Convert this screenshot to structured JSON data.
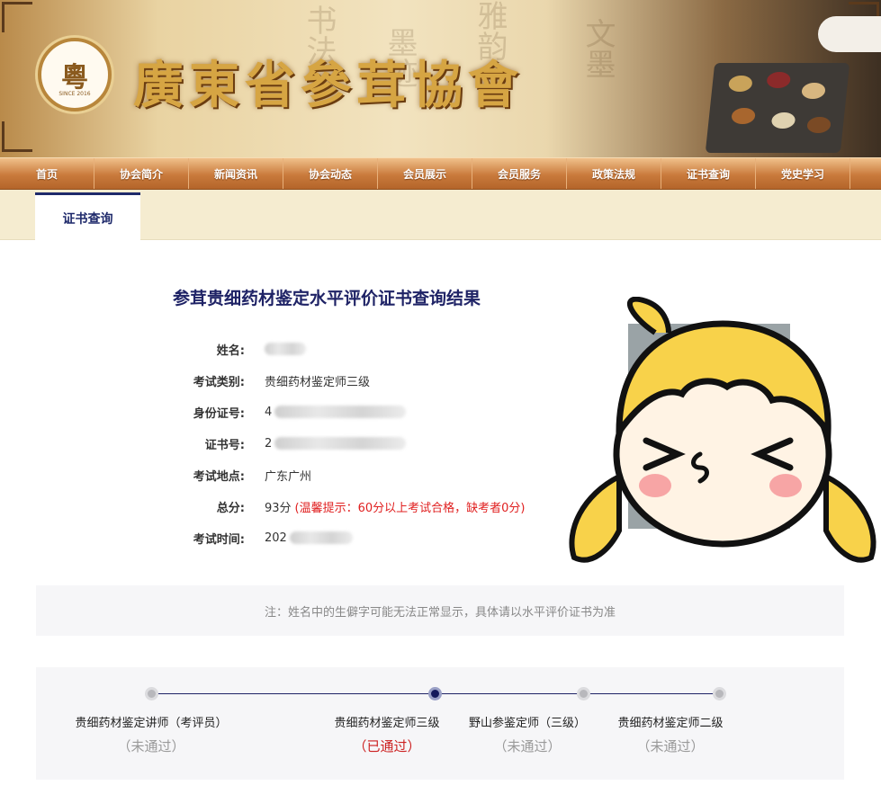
{
  "header": {
    "site_title": "廣東省參茸協會",
    "logo_mark": "粵",
    "logo_since": "SINCE 2016"
  },
  "nav": {
    "items": [
      "首页",
      "协会简介",
      "新闻资讯",
      "协会动态",
      "会员展示",
      "会员服务",
      "政策法规",
      "证书查询",
      "党史学习"
    ]
  },
  "tab": {
    "label": "证书查询"
  },
  "result": {
    "title": "参茸贵细药材鉴定水平评价证书查询结果",
    "fields": [
      {
        "label": "姓名:",
        "value": ""
      },
      {
        "label": "考试类别:",
        "value": "贵细药材鉴定师三级"
      },
      {
        "label": "身份证号:",
        "value": "4"
      },
      {
        "label": "证书号:",
        "value": "2"
      },
      {
        "label": "考试地点:",
        "value": "广东广州"
      },
      {
        "label": "总分:",
        "value": "93分",
        "hint": "(温馨提示：60分以上考试合格，缺考者0分)"
      },
      {
        "label": "考试时间:",
        "value": "202"
      }
    ]
  },
  "note": {
    "text": "注：姓名中的生僻字可能无法正常显示，具体请以水平评价证书为准"
  },
  "progress": {
    "steps": [
      {
        "label": "贵细药材鉴定讲师（考评员）",
        "status": "（未通过）",
        "passed": false
      },
      {
        "label": "贵细药材鉴定师三级",
        "status": "（已通过）",
        "passed": true
      },
      {
        "label": "野山参鉴定师（三级）",
        "status": "（未通过）",
        "passed": false
      },
      {
        "label": "贵细药材鉴定师二级",
        "status": "（未通过）",
        "passed": false
      }
    ]
  },
  "colors": {
    "accent": "#1f2366",
    "nav": "#c97a3c",
    "passed": "#cc1f1f",
    "hint": "#e02020"
  }
}
